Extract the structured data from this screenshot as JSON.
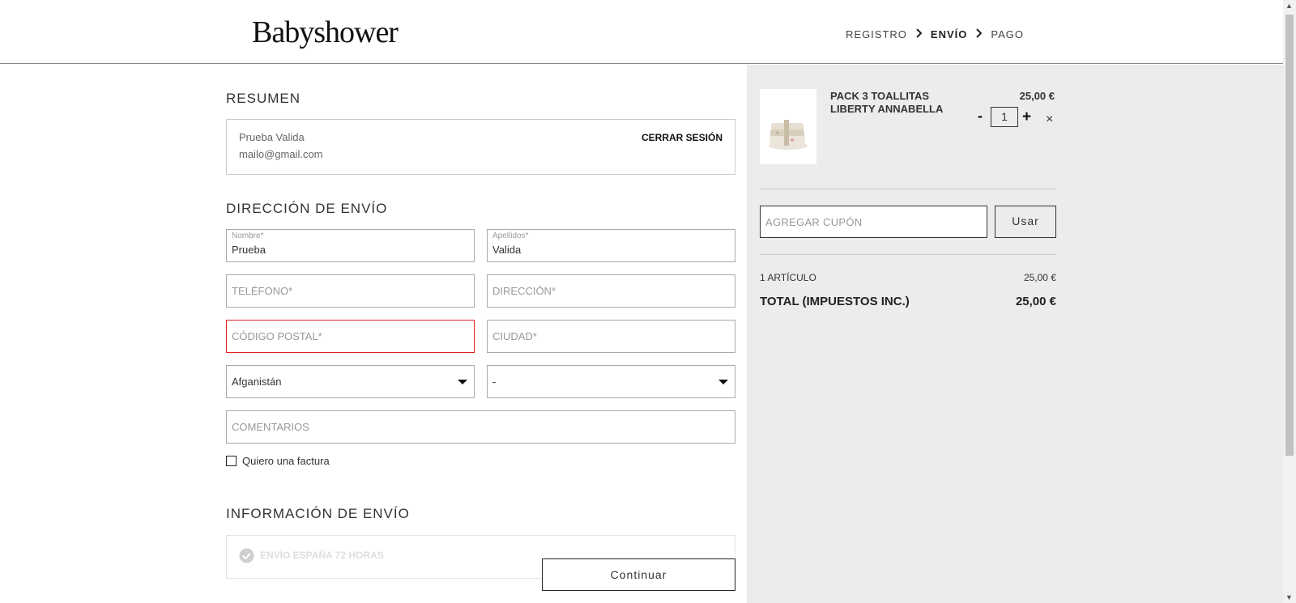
{
  "brand": {
    "logo": "Babyshower"
  },
  "steps": {
    "registro": "REGISTRO",
    "envio": "ENVÍO",
    "pago": "PAGO"
  },
  "summary": {
    "title": "RESUMEN",
    "user_name": "Prueba Valida",
    "user_email": "mailo@gmail.com",
    "logout_label": "CERRAR SESIÓN"
  },
  "shipping_address": {
    "title": "DIRECCIÓN DE ENVÍO",
    "nombre_label": "Nombre*",
    "nombre_value": "Prueba",
    "apellidos_label": "Apellidos*",
    "apellidos_value": "Valida",
    "telefono_placeholder": "TELÉFONO*",
    "direccion_placeholder": "DIRECCIÓN*",
    "codigo_postal_placeholder": "CÓDIGO POSTAL*",
    "ciudad_placeholder": "CIUDAD*",
    "country_selected": "Afganistán",
    "province_selected": "-",
    "comments_placeholder": "COMENTARIOS",
    "invoice_label": "Quiero una factura"
  },
  "shipping_info": {
    "title": "INFORMACIÓN DE ENVÍO",
    "option_label": "ENVÍO ESPAÑA 72 HORAS"
  },
  "continue_label": "Continuar",
  "cart": {
    "product_name_line1": "PACK 3 TOALLITAS",
    "product_name_line2": "LIBERTY ANNABELLA",
    "product_price": "25,00 €",
    "quantity": "1",
    "minus": "-",
    "plus": "+",
    "remove": "×",
    "coupon_placeholder": "AGREGAR CUPÓN",
    "coupon_button": "Usar",
    "items_label": "1 ARTÍCULO",
    "items_total": "25,00 €",
    "total_label": "TOTAL (IMPUESTOS INC.)",
    "total_value": "25,00 €"
  },
  "colors": {
    "error_border": "#e02020",
    "panel_bg": "#ececec",
    "check_icon": "#cfcfcf"
  },
  "icons": [
    "chevron-right-icon",
    "caret-down-icon",
    "check-circle-icon",
    "close-icon"
  ]
}
